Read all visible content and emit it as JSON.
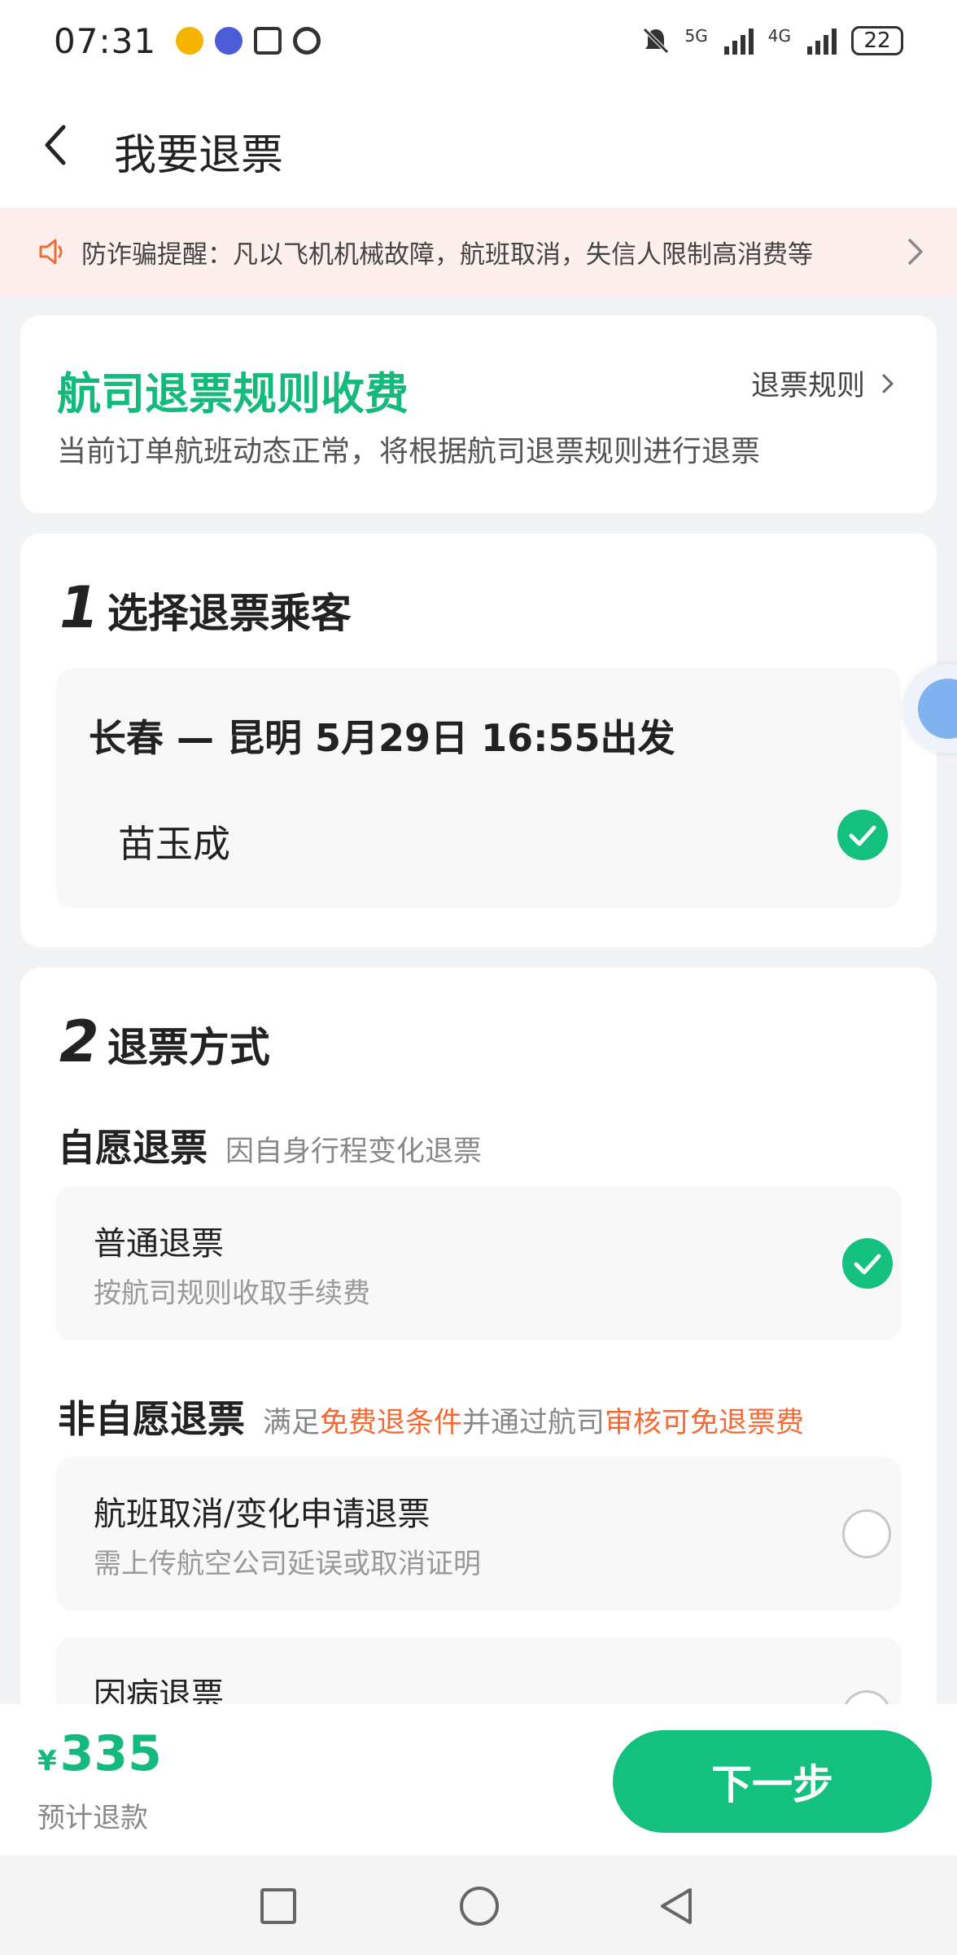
{
  "status_bar": {
    "time": "07:31",
    "signal1_label": "5G",
    "signal2_label": "4G",
    "battery": "22"
  },
  "header": {
    "title": "我要退票"
  },
  "notice": {
    "text": "防诈骗提醒：凡以飞机机械故障，航班取消，失信人限制高消费等"
  },
  "rule_card": {
    "title": "航司退票规则收费",
    "link_label": "退票规则",
    "description": "当前订单航班动态正常，将根据航司退票规则进行退票"
  },
  "passenger_section": {
    "number": "1",
    "title": "选择退票乘客",
    "flight_info": "长春 — 昆明  5月29日  16:55出发",
    "passenger_name": "苗玉成"
  },
  "method_section": {
    "number": "2",
    "title": "退票方式",
    "voluntary": {
      "label": "自愿退票",
      "description": "因自身行程变化退票"
    },
    "voluntary_option": {
      "title": "普通退票",
      "subtitle": "按航司规则收取手续费"
    },
    "involuntary": {
      "label": "非自愿退票",
      "desc_part1": "满足",
      "desc_highlight1": "免费退条件",
      "desc_part2": "并通过航司",
      "desc_highlight2": "审核可免退票费"
    },
    "involuntary_options": [
      {
        "title": "航班取消/变化申请退票",
        "subtitle": "需上传航空公司延误或取消证明"
      },
      {
        "title": "因病退票",
        "subtitle": ""
      }
    ]
  },
  "bottom_bar": {
    "currency": "¥",
    "amount": "335",
    "amount_label": "预计退款",
    "next_label": "下一步"
  },
  "colors": {
    "accent_green": "#13c07e",
    "highlight_orange": "#f46a34",
    "notice_bg": "#fdf0ec"
  }
}
